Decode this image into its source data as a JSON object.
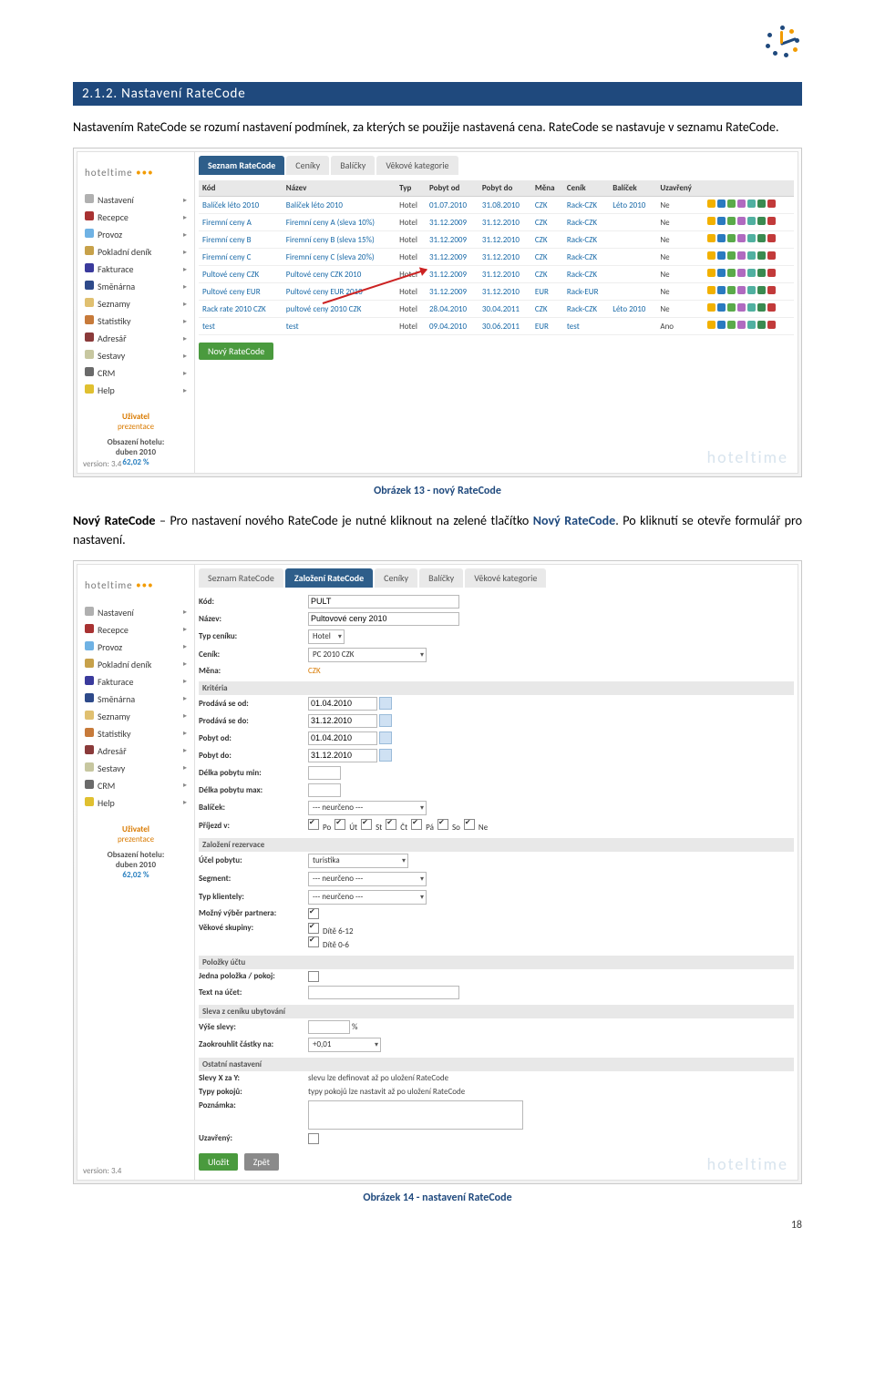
{
  "heading": "2.1.2. Nastavení RateCode",
  "para1": "Nastavením RateCode se rozumí nastavení podmínek, za kterých se použije nastavená cena. RateCode se nastavuje v seznamu RateCode.",
  "caption1": "Obrázek 13 - nový RateCode",
  "para2_prefix": "Nový RateCode",
  "para2_mid": " – Pro nastavení nového RateCode je nutné kliknout na zelené tlačítko ",
  "para2_link": "Nový RateCode",
  "para2_suffix": ". Po kliknutí se otevře formulář pro nastavení.",
  "caption2": "Obrázek 14 - nastavení RateCode",
  "page_number": "18",
  "brand": "hoteltime",
  "watermark": "hoteltime",
  "sidebar": {
    "items": [
      {
        "label": "Nastavení",
        "color": "#b0b0b0"
      },
      {
        "label": "Recepce",
        "color": "#a83232"
      },
      {
        "label": "Provoz",
        "color": "#6fb2e4"
      },
      {
        "label": "Pokladní deník",
        "color": "#c7a14a"
      },
      {
        "label": "Fakturace",
        "color": "#3a3a9c"
      },
      {
        "label": "Směnárna",
        "color": "#2e4a8a"
      },
      {
        "label": "Seznamy",
        "color": "#e0c070"
      },
      {
        "label": "Statistiky",
        "color": "#c77a3a"
      },
      {
        "label": "Adresář",
        "color": "#8a3a3a"
      },
      {
        "label": "Sestavy",
        "color": "#c7c7a0"
      },
      {
        "label": "CRM",
        "color": "#6a6a6a"
      },
      {
        "label": "Help",
        "color": "#e0c030"
      }
    ],
    "user_label": "Uživatel",
    "user_role": "prezentace",
    "occupancy_label": "Obsazení hotelu:",
    "occupancy_month": "duben 2010",
    "occupancy_pct": "62,02 %",
    "version": "version: 3.4"
  },
  "tabs1": [
    "Seznam RateCode",
    "Ceníky",
    "Balíčky",
    "Věkové kategorie"
  ],
  "table1": {
    "cols": [
      "Kód",
      "Název",
      "Typ",
      "Pobyt od",
      "Pobyt do",
      "Měna",
      "Ceník",
      "Balíček",
      "Uzavřený"
    ],
    "rows": [
      [
        "Balíček léto 2010",
        "Balíček léto 2010",
        "Hotel",
        "01.07.2010",
        "31.08.2010",
        "CZK",
        "Rack-CZK",
        "Léto 2010",
        "Ne"
      ],
      [
        "Firemní ceny A",
        "Firemní ceny A (sleva 10%)",
        "Hotel",
        "31.12.2009",
        "31.12.2010",
        "CZK",
        "Rack-CZK",
        "",
        "Ne"
      ],
      [
        "Firemní ceny B",
        "Firemní ceny B (sleva 15%)",
        "Hotel",
        "31.12.2009",
        "31.12.2010",
        "CZK",
        "Rack-CZK",
        "",
        "Ne"
      ],
      [
        "Firemní ceny C",
        "Firemní ceny C (sleva 20%)",
        "Hotel",
        "31.12.2009",
        "31.12.2010",
        "CZK",
        "Rack-CZK",
        "",
        "Ne"
      ],
      [
        "Pultové ceny CZK",
        "Pultové ceny CZK 2010",
        "Hotel",
        "31.12.2009",
        "31.12.2010",
        "CZK",
        "Rack-CZK",
        "",
        "Ne"
      ],
      [
        "Pultové ceny EUR",
        "Pultové ceny EUR 2010",
        "Hotel",
        "31.12.2009",
        "31.12.2010",
        "EUR",
        "Rack-EUR",
        "",
        "Ne"
      ],
      [
        "Rack rate 2010 CZK",
        "pultové ceny 2010 CZK",
        "Hotel",
        "28.04.2010",
        "30.04.2011",
        "CZK",
        "Rack-CZK",
        "Léto 2010",
        "Ne"
      ],
      [
        "test",
        "test",
        "Hotel",
        "09.04.2010",
        "30.06.2011",
        "EUR",
        "test",
        "",
        "Ano"
      ]
    ]
  },
  "btn_new": "Nový RateCode",
  "tabs2": [
    "Seznam RateCode",
    "Založení RateCode",
    "Ceníky",
    "Balíčky",
    "Věkové kategorie"
  ],
  "form": {
    "kod": {
      "label": "Kód:",
      "value": "PULT"
    },
    "nazev": {
      "label": "Název:",
      "value": "Pultovové ceny 2010"
    },
    "typ": {
      "label": "Typ ceníku:",
      "value": "Hotel"
    },
    "cenik": {
      "label": "Ceník:",
      "value": "PC 2010 CZK"
    },
    "mena": {
      "label": "Měna:",
      "value": "CZK"
    },
    "kriteria": "Kritéria",
    "prodava_od": {
      "label": "Prodává se od:",
      "value": "01.04.2010"
    },
    "prodava_do": {
      "label": "Prodává se do:",
      "value": "31.12.2010"
    },
    "pobyt_od": {
      "label": "Pobyt od:",
      "value": "01.04.2010"
    },
    "pobyt_do": {
      "label": "Pobyt do:",
      "value": "31.12.2010"
    },
    "delka_min": {
      "label": "Délka pobytu min:",
      "value": ""
    },
    "delka_max": {
      "label": "Délka pobytu max:",
      "value": ""
    },
    "balicek": {
      "label": "Balíček:",
      "value": "--- neurčeno ---"
    },
    "prijezd": {
      "label": "Příjezd v:",
      "days": [
        "Po",
        "Út",
        "St",
        "Čt",
        "Pá",
        "So",
        "Ne"
      ]
    },
    "zalozeni": "Založení rezervace",
    "ucel": {
      "label": "Účel pobytu:",
      "value": "turistika"
    },
    "segment": {
      "label": "Segment:",
      "value": "--- neurčeno ---"
    },
    "klientely": {
      "label": "Typ klientely:",
      "value": "--- neurčeno ---"
    },
    "partner": {
      "label": "Možný výběr partnera:",
      "checked": true
    },
    "vek": {
      "label": "Věkové skupiny:",
      "items": [
        "Dítě 6-12",
        "Dítě 0-6"
      ]
    },
    "polozky": "Položky účtu",
    "jedna": {
      "label": "Jedna položka / pokoj:",
      "checked": false
    },
    "text_ucet": {
      "label": "Text na účet:",
      "value": ""
    },
    "sleva": "Sleva z ceníku ubytování",
    "vyse": {
      "label": "Výše slevy:",
      "value": "",
      "unit": "%"
    },
    "zaokr": {
      "label": "Zaokrouhlit částky na:",
      "value": "+0,01"
    },
    "ostatni": "Ostatní nastavení",
    "slevyxy": {
      "label": "Slevy X za Y:",
      "note": "slevu lze definovat až po uložení RateCode"
    },
    "typypok": {
      "label": "Typy pokojů:",
      "note": "typy pokojů lze nastavit až po uložení RateCode"
    },
    "poznamka": {
      "label": "Poznámka:",
      "value": ""
    },
    "uzavreny": {
      "label": "Uzavřený:",
      "checked": false
    },
    "save": "Uložit",
    "back": "Zpět"
  }
}
